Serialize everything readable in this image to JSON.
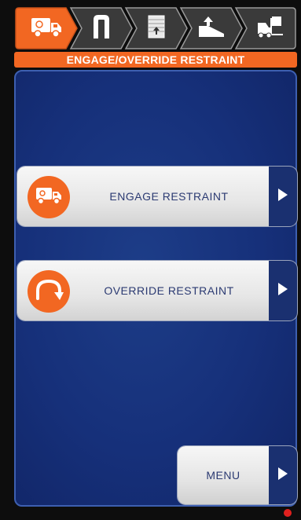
{
  "tabs": [
    {
      "icon": "truck-icon",
      "active": true
    },
    {
      "icon": "restraint-hook-icon",
      "active": false
    },
    {
      "icon": "door-icon",
      "active": false
    },
    {
      "icon": "leveler-icon",
      "active": false
    },
    {
      "icon": "forklift-icon",
      "active": false
    }
  ],
  "header": {
    "title": "ENGAGE/OVERRIDE RESTRAINT"
  },
  "actions": [
    {
      "label": "ENGAGE RESTRAINT",
      "icon": "truck-icon",
      "arrow_icon": "play-arrow-icon"
    },
    {
      "label": "OVERRIDE RESTRAINT",
      "icon": "override-arrow-icon",
      "arrow_icon": "play-arrow-icon"
    }
  ],
  "menu": {
    "label": "MENU",
    "arrow_icon": "play-arrow-icon"
  },
  "status_light": {
    "color": "#e0201e"
  },
  "colors": {
    "accent": "#f26722",
    "panel": "#16307a",
    "tab_inactive": "#3a3a3a",
    "button_text": "#2b3a72"
  }
}
